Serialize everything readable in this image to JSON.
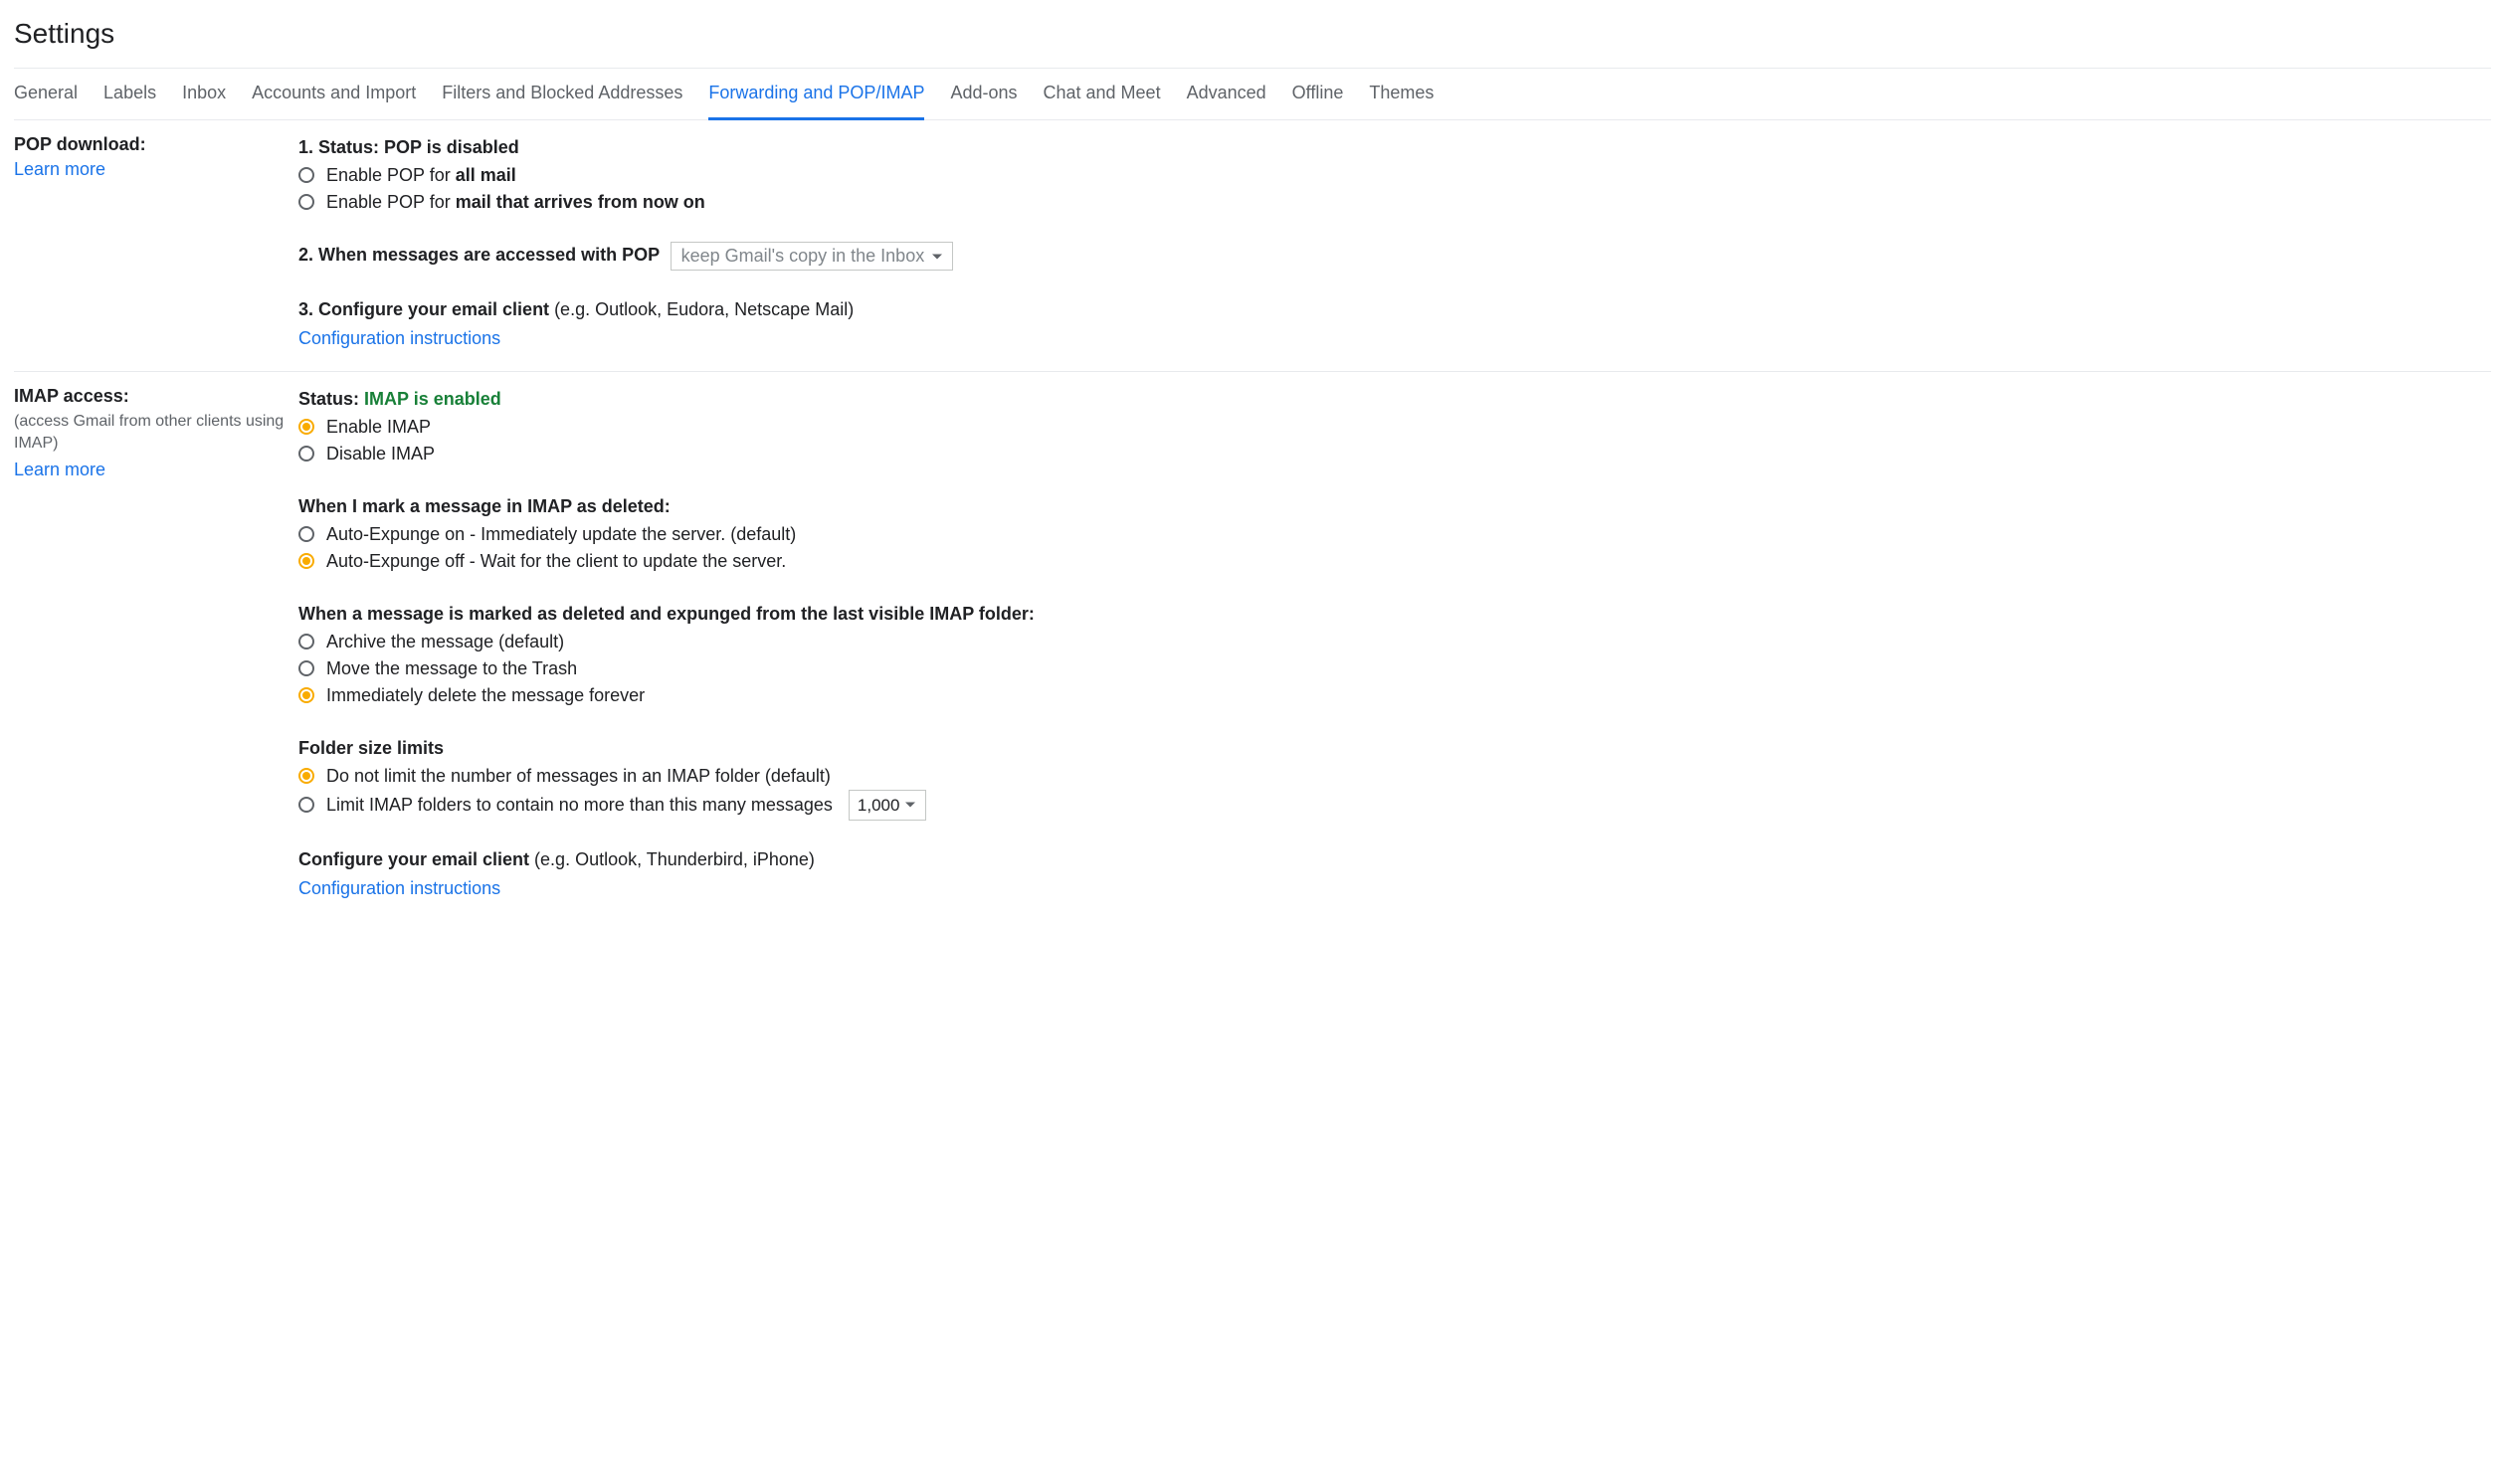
{
  "title": "Settings",
  "tabs": {
    "general": "General",
    "labels": "Labels",
    "inbox": "Inbox",
    "accounts": "Accounts and Import",
    "filters": "Filters and Blocked Addresses",
    "forwarding": "Forwarding and POP/IMAP",
    "addons": "Add-ons",
    "chat": "Chat and Meet",
    "advanced": "Advanced",
    "offline": "Offline",
    "themes": "Themes"
  },
  "pop": {
    "heading": "POP download:",
    "learn_more": "Learn more",
    "status_prefix": "1. Status: ",
    "status_value": "POP is disabled",
    "enable_all_pre": "Enable POP for ",
    "enable_all_bold": "all mail",
    "enable_now_pre": "Enable POP for ",
    "enable_now_bold": "mail that arrives from now on",
    "when_accessed_label": "2. When messages are accessed with POP",
    "when_accessed_value": "keep Gmail's copy in the Inbox",
    "configure_bold": "3. Configure your email client ",
    "configure_rest": "(e.g. Outlook, Eudora, Netscape Mail)",
    "config_link": "Configuration instructions"
  },
  "imap": {
    "heading": "IMAP access:",
    "sub": "(access Gmail from other clients using IMAP)",
    "learn_more": "Learn more",
    "status_prefix": "Status: ",
    "status_value": "IMAP is enabled",
    "enable": "Enable IMAP",
    "disable": "Disable IMAP",
    "deleted_heading": "When I mark a message in IMAP as deleted:",
    "expunge_on": "Auto-Expunge on - Immediately update the server. (default)",
    "expunge_off": "Auto-Expunge off - Wait for the client to update the server.",
    "expunged_heading": "When a message is marked as deleted and expunged from the last visible IMAP folder:",
    "archive": "Archive the message (default)",
    "trash": "Move the message to the Trash",
    "delete_forever": "Immediately delete the message forever",
    "folder_heading": "Folder size limits",
    "no_limit": "Do not limit the number of messages in an IMAP folder (default)",
    "limit": "Limit IMAP folders to contain no more than this many messages",
    "limit_value": "1,000",
    "configure_bold": "Configure your email client ",
    "configure_rest": "(e.g. Outlook, Thunderbird, iPhone)",
    "config_link": "Configuration instructions"
  }
}
